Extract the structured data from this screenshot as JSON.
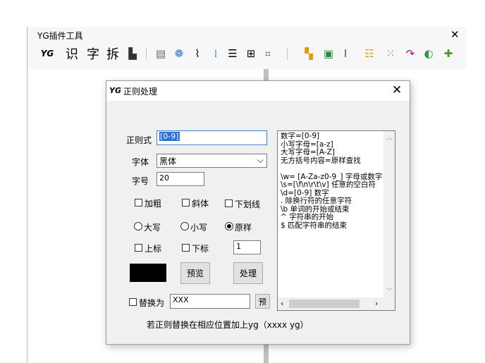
{
  "toolbar": {
    "title": "YG插件工具",
    "close": "✕",
    "items": [
      {
        "name": "yg-logo",
        "glyph": "YG",
        "color": "#000000"
      },
      {
        "name": "recognize-char",
        "glyph": "识",
        "color": "#000000"
      },
      {
        "name": "char",
        "glyph": "字",
        "color": "#000000"
      },
      {
        "name": "split",
        "glyph": "拆",
        "color": "#000000"
      },
      {
        "name": "paste",
        "glyph": "▙",
        "color": "#333333"
      },
      {
        "name": "table",
        "glyph": "▤",
        "color": "#666666"
      },
      {
        "name": "pattern",
        "glyph": "❁",
        "color": "#2a6fd6"
      },
      {
        "name": "wave",
        "glyph": "⌇",
        "color": "#000000"
      },
      {
        "name": "grid-dots",
        "glyph": "⁞",
        "color": "#2a6fd6"
      },
      {
        "name": "lines",
        "glyph": "☰",
        "color": "#000000"
      },
      {
        "name": "align",
        "glyph": "⊞",
        "color": "#000000"
      },
      {
        "name": "select",
        "glyph": "⌗",
        "color": "#555555"
      },
      {
        "name": "color-grid",
        "glyph": "▚",
        "color": "#e09a10"
      },
      {
        "name": "picture",
        "glyph": "▣",
        "color": "#2a8a3a"
      },
      {
        "name": "text-format",
        "glyph": "Ⅰ",
        "color": "#555555"
      },
      {
        "name": "list",
        "glyph": "☷",
        "color": "#e0a000"
      },
      {
        "name": "dots",
        "glyph": "⁙",
        "color": "#888888"
      },
      {
        "name": "redo",
        "glyph": "↷",
        "color": "#b0107a"
      },
      {
        "name": "palette",
        "glyph": "◐",
        "color": "#2a9a3a"
      },
      {
        "name": "plugin",
        "glyph": "✚",
        "color": "#4a9a2a"
      }
    ]
  },
  "dialog": {
    "title_icon": "YG",
    "title": "正则处理",
    "close": "✕",
    "regex_label": "正则式",
    "regex_value": "[0-9]",
    "font_label": "字体",
    "font_value": "黑体",
    "size_label": "字号",
    "size_value": "20",
    "bold_label": "加粗",
    "italic_label": "斜体",
    "underline_label": "下划线",
    "upper_label": "大写",
    "lower_label": "小写",
    "original_label": "原样",
    "superscript_label": "上标",
    "subscript_label": "下标",
    "counter_value": "1",
    "color_swatch": "#000000",
    "preview_button": "预览",
    "process_button": "处理",
    "replace_label": "替换为",
    "replace_value": "XXX",
    "replace_preview_button": "预",
    "hint": "若正则替换在相应位置加上yg（xxxx yg）",
    "help_lines": [
      "数字=[0-9]",
      "小写字母=[a-z]",
      "大写字母=[A-Z]",
      "无方括号内容=原样查找",
      "",
      "\\w= [A-Za-z0-9_] 字母或数字",
      "\\s=[\\f\\n\\r\\t\\v] 任意的空白符",
      "\\d=[0-9] 数字",
      ". 除换行符的任意字符",
      "\\b 单词的开始或结束",
      "^ 字符串的开始",
      "$ 匹配字符串的结束"
    ]
  }
}
